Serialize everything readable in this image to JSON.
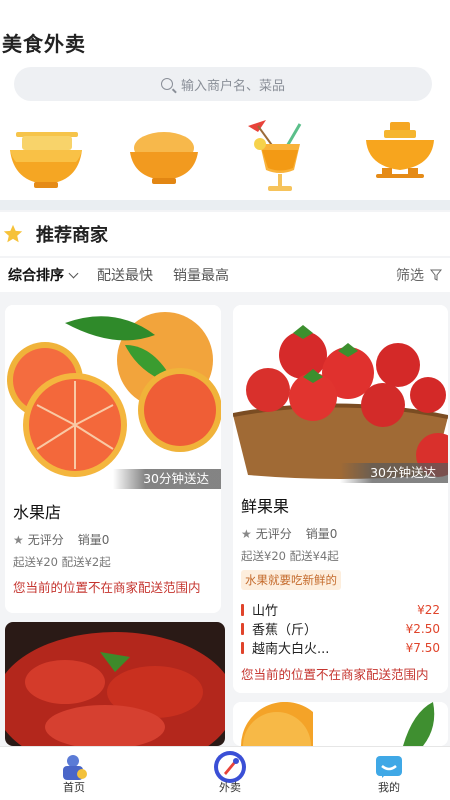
{
  "app": {
    "title": "美食外卖"
  },
  "search": {
    "placeholder": "输入商户名、菜品"
  },
  "categories": [
    {
      "icon": "noodle-bowl-icon"
    },
    {
      "icon": "rice-bowl-icon"
    },
    {
      "icon": "drink-cup-icon"
    },
    {
      "icon": "hotpot-icon"
    }
  ],
  "section": {
    "title": "推荐商家"
  },
  "sort": {
    "items": [
      "综合排序",
      "配送最快",
      "销量最高"
    ],
    "filter": "筛选"
  },
  "shops": [
    {
      "name": "水果店",
      "delivery": "30分钟送达",
      "rating": "无评分",
      "sales": "销量0",
      "fee": "起送¥20 配送¥2起",
      "warning": "您当前的位置不在商家配送范围内"
    },
    {
      "name": "鲜果果",
      "delivery": "30分钟送达",
      "rating": "无评分",
      "sales": "销量0",
      "fee": "起送¥20 配送¥4起",
      "slogan": "水果就要吃新鲜的",
      "items": [
        {
          "name": "山竹",
          "price": "¥22"
        },
        {
          "name": "香蕉（斤）",
          "price": "¥2.50"
        },
        {
          "name": "越南大白火...",
          "price": "¥7.50"
        }
      ],
      "warning": "您当前的位置不在商家配送范围内"
    }
  ],
  "tabbar": {
    "items": [
      {
        "label": "首页",
        "icon": "home-icon"
      },
      {
        "label": "外卖",
        "icon": "takeout-icon"
      },
      {
        "label": "我的",
        "icon": "profile-icon"
      }
    ]
  },
  "colors": {
    "accent": "#f29a1f",
    "price": "#e0442b",
    "warning": "#c5352f"
  }
}
